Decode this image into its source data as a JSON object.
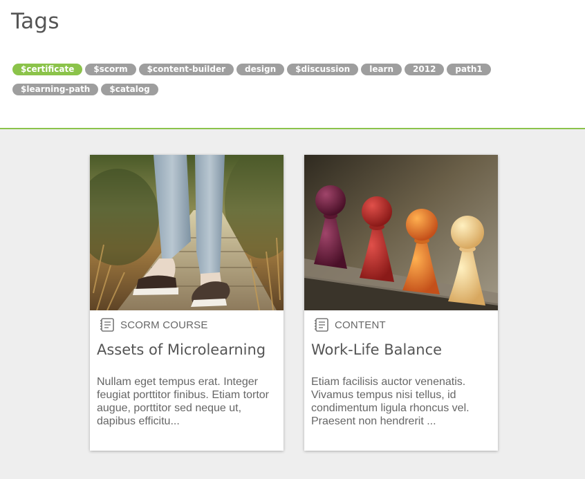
{
  "header": {
    "title": "Tags",
    "tags": [
      {
        "label": "$certificate",
        "active": true
      },
      {
        "label": "$scorm",
        "active": false
      },
      {
        "label": "$content-builder",
        "active": false
      },
      {
        "label": "design",
        "active": false
      },
      {
        "label": "$discussion",
        "active": false
      },
      {
        "label": "learn",
        "active": false
      },
      {
        "label": "2012",
        "active": false
      },
      {
        "label": "path1",
        "active": false
      },
      {
        "label": "$learning-path",
        "active": false
      },
      {
        "label": "$catalog",
        "active": false
      }
    ]
  },
  "colors": {
    "accent": "#8bc34a",
    "tag_default": "#9e9e9e",
    "content_background": "#eeeeee"
  },
  "cards": [
    {
      "type_icon": "course-book-icon",
      "type_label": "SCORM COURSE",
      "title": "Assets of Microlearning",
      "description": "Nullam eget tempus erat. Integer feugiat porttitor finibus. Etiam tortor augue, porttitor sed neque ut, dapibus efficitu...",
      "image": "photo of legs in jeans and sneakers on a wooden forest path"
    },
    {
      "type_icon": "content-book-icon",
      "type_label": "CONTENT",
      "title": "Work-Life Balance",
      "description": "Etiam facilisis auctor venenatis. Vivamus tempus nisi tellus, id condimentum ligula rhoncus vel. Praesent non hendrerit ...",
      "image": "photo of colored wooden game pawns in a diagonal row"
    }
  ]
}
